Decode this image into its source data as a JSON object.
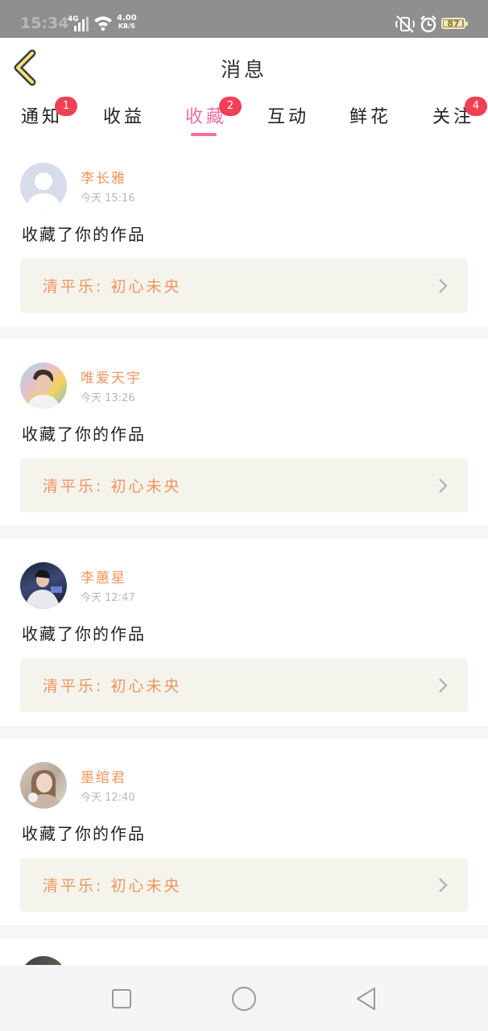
{
  "status_bar": {
    "time": "15:34",
    "signal": "4G",
    "speed_value": "4.00",
    "speed_unit": "KB/S",
    "battery": "87",
    "icons": [
      "signal-icon",
      "wifi-icon",
      "silent-icon",
      "alarm-icon",
      "battery-icon"
    ]
  },
  "header": {
    "title": "消息",
    "back_icon": "chevron-left-icon"
  },
  "tabs": [
    {
      "label": "通知",
      "badge": "1"
    },
    {
      "label": "收益",
      "badge": ""
    },
    {
      "label": "收藏",
      "badge": "2",
      "active": true
    },
    {
      "label": "互动",
      "badge": ""
    },
    {
      "label": "鲜花",
      "badge": ""
    },
    {
      "label": "关注",
      "badge": "4"
    }
  ],
  "feed": [
    {
      "username": "李长雅",
      "time": "今天 15:16",
      "action": "收藏了你的作品",
      "work": "清平乐: 初心未央"
    },
    {
      "username": "唯爱天宇",
      "time": "今天 13:26",
      "action": "收藏了你的作品",
      "work": "清平乐: 初心未央"
    },
    {
      "username": "李蕙星",
      "time": "今天 12:47",
      "action": "收藏了你的作品",
      "work": "清平乐: 初心未央"
    },
    {
      "username": "墨绾君",
      "time": "今天 12:40",
      "action": "收藏了你的作品",
      "work": "清平乐: 初心未央"
    }
  ],
  "nav": {
    "icons": [
      "recents-square-icon",
      "home-circle-icon",
      "back-triangle-icon"
    ]
  },
  "colors": {
    "accent": "#ee6fa2",
    "orange": "#f0955f",
    "badge": "#f04056",
    "work_bg": "#f4f4ec"
  }
}
